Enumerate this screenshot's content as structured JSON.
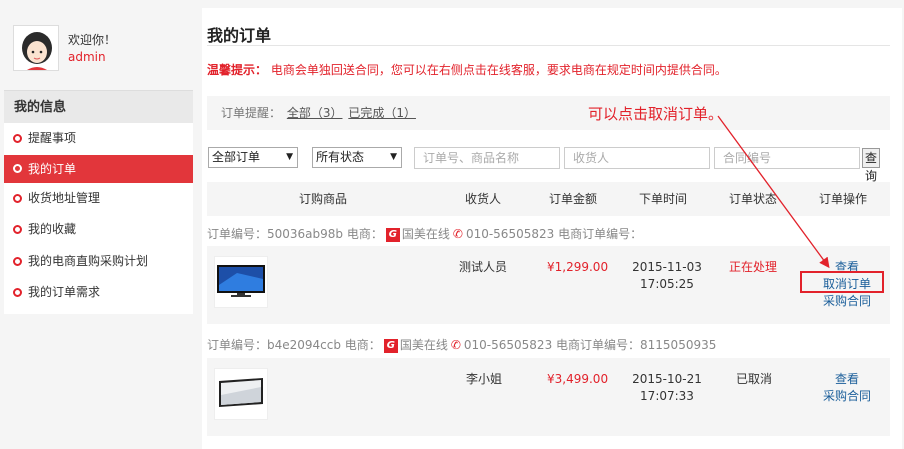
{
  "profile": {
    "welcome": "欢迎你！",
    "username": "admin"
  },
  "sidebar": {
    "heading": "我的信息",
    "items": [
      {
        "label": "提醒事项"
      },
      {
        "label": "我的订单"
      },
      {
        "label": "收货地址管理"
      },
      {
        "label": "我的收藏"
      },
      {
        "label": "我的电商直购采购计划"
      },
      {
        "label": "我的订单需求"
      }
    ],
    "active_index": 1
  },
  "main": {
    "title": "我的订单",
    "notice_label": "温馨提示：",
    "notice_text": "电商会单独回送合同，您可以在右侧点击在线客服，要求电商在规定时间内提供合同。",
    "remind_label": "订单提醒：",
    "remind_all": "全部（3）",
    "remind_done": "已完成（1）",
    "annotation": "可以点击取消订单。"
  },
  "filters": {
    "order_type": "全部订单",
    "status": "所有状态",
    "order_search_placeholder": "订单号、商品名称",
    "receiver_placeholder": "收货人",
    "contract_placeholder": "合同编号",
    "search_label": "查询"
  },
  "table": {
    "headers": [
      "订购商品",
      "收货人",
      "订单金额",
      "下单时间",
      "订单状态",
      "订单操作"
    ]
  },
  "orders": [
    {
      "head_prefix": "订单编号：50036ab98b 电商：",
      "vendor": "国美在线",
      "phone_and_no": "010-56505823 电商订单编号：",
      "receiver": "测试人员",
      "amount": "¥1,299.00",
      "date": "2015-11-03",
      "time": "17:05:25",
      "status": "正在处理",
      "status_color": "#e2222b",
      "actions": [
        "查看",
        "取消订单",
        "采购合同"
      ]
    },
    {
      "head_prefix": "订单编号：b4e2094ccb 电商：",
      "vendor": "国美在线",
      "phone_and_no": "010-56505823 电商订单编号：8115050935",
      "receiver": "李小姐",
      "amount": "¥3,499.00",
      "date": "2015-10-21",
      "time": "17:07:33",
      "status": "已取消",
      "status_color": "#333333",
      "actions": [
        "查看",
        "采购合同"
      ]
    }
  ],
  "colors": {
    "accent": "#e2222b",
    "link": "#1a5e9a"
  }
}
